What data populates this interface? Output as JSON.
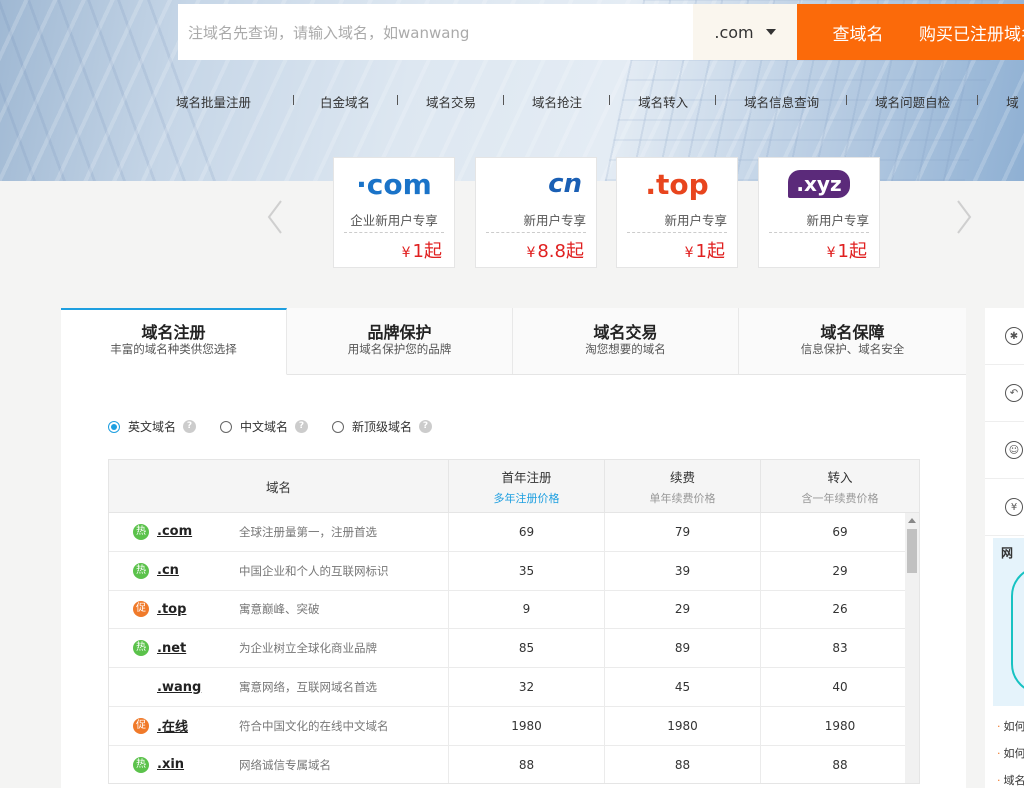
{
  "search": {
    "placeholder": "注域名先查询，请输入域名，如wanwang",
    "tld": ".com",
    "search_button": "查域名",
    "buy_button": "购买已注册域名"
  },
  "quicknav": [
    "域名批量注册",
    "白金域名",
    "域名交易",
    "域名抢注",
    "域名转入",
    "域名信息查询",
    "域名问题自检",
    "域"
  ],
  "promos": [
    {
      "logo": "·com",
      "desc": "企业新用户专享",
      "price": "1起"
    },
    {
      "logo": "cn",
      "desc": "新用户专享",
      "price": "8.8起"
    },
    {
      "logo": ".top",
      "desc": "新用户专享",
      "price": "1起"
    },
    {
      "logo": ".xyz",
      "desc": "新用户专享",
      "price": "1起"
    }
  ],
  "currency": "¥",
  "tabs": [
    {
      "title": "域名注册",
      "sub": "丰富的域名种类供您选择"
    },
    {
      "title": "品牌保护",
      "sub": "用域名保护您的品牌"
    },
    {
      "title": "域名交易",
      "sub": "淘您想要的域名"
    },
    {
      "title": "域名保障",
      "sub": "信息保护、域名安全"
    }
  ],
  "radios": [
    "英文域名",
    "中文域名",
    "新顶级域名"
  ],
  "table": {
    "headers": {
      "name": "域名",
      "first_year": "首年注册",
      "first_year_sub": "多年注册价格",
      "renew": "续费",
      "renew_sub": "单年续费价格",
      "transfer": "转入",
      "transfer_sub": "含一年续费价格"
    },
    "rows": [
      {
        "badge": "热",
        "badge_type": "hot",
        "suffix": ".com",
        "desc": "全球注册量第一，注册首选",
        "first": "69",
        "renew": "79",
        "transfer": "69"
      },
      {
        "badge": "热",
        "badge_type": "hot",
        "suffix": ".cn",
        "desc": "中国企业和个人的互联网标识",
        "first": "35",
        "renew": "39",
        "transfer": "29"
      },
      {
        "badge": "促",
        "badge_type": "promo",
        "suffix": ".top",
        "desc": "寓意巅峰、突破",
        "first": "9",
        "renew": "29",
        "transfer": "26"
      },
      {
        "badge": "热",
        "badge_type": "hot",
        "suffix": ".net",
        "desc": "为企业树立全球化商业品牌",
        "first": "85",
        "renew": "89",
        "transfer": "83"
      },
      {
        "badge": "",
        "badge_type": "none",
        "suffix": ".wang",
        "desc": "寓意网络，互联网域名首选",
        "first": "32",
        "renew": "45",
        "transfer": "40"
      },
      {
        "badge": "促",
        "badge_type": "promo",
        "suffix": ".在线",
        "desc": "符合中国文化的在线中文域名",
        "first": "1980",
        "renew": "1980",
        "transfer": "1980"
      },
      {
        "badge": "热",
        "badge_type": "hot",
        "suffix": ".xin",
        "desc": "网络诚信专属域名",
        "first": "88",
        "renew": "88",
        "transfer": "88"
      }
    ]
  },
  "side": {
    "box_title": "网",
    "links": [
      "如何",
      "如何",
      "域名"
    ]
  }
}
